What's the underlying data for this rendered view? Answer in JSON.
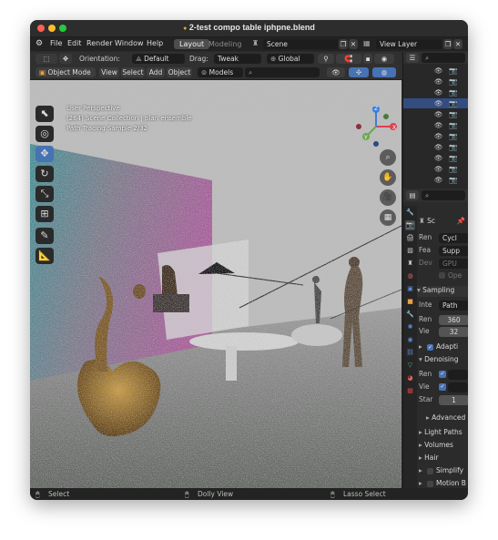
{
  "window": {
    "title": "2-test compo table iphpne.blend",
    "modified_dot": "●"
  },
  "menubar": {
    "file": "File",
    "edit": "Edit",
    "render": "Render",
    "window": "Window",
    "help": "Help",
    "tab_layout": "Layout",
    "tab_modeling": "Modeling",
    "scene": "Scene",
    "view_layer": "View Layer"
  },
  "toolbar1": {
    "orientation_label": "Orientation:",
    "orientation_value": "Default",
    "drag_label": "Drag:",
    "drag_value": "Tweak",
    "transform_value": "Global"
  },
  "toolbar2": {
    "mode": "Object Mode",
    "view": "View",
    "select": "Select",
    "add": "Add",
    "object": "Object",
    "collection": "Models"
  },
  "viewport": {
    "line1": "User Perspective",
    "line2": "(264) Scene Collection | plan ensemble",
    "line3": "Path Tracing Sample 2/32",
    "gizmo_x": "X",
    "gizmo_y": "Y",
    "gizmo_z": "Z"
  },
  "properties": {
    "tab_scene": "Sc",
    "ren_label": "Ren",
    "ren_value": "Cycl",
    "fea_label": "Fea",
    "fea_value": "Supp",
    "dev_label": "Dev",
    "dev_value": "GPU",
    "ope_label": "Ope",
    "sampling": "Sampling",
    "inte_label": "Inte",
    "inte_value": "Path",
    "render_label": "Ren",
    "render_samples": "360",
    "view_label": "Vie",
    "view_samples": "32",
    "adaptive": "Adapti",
    "denoising": "Denoising",
    "den_ren": "Ren",
    "den_vie": "Vie",
    "start_label": "Star",
    "start_value": "1",
    "advanced": "Advanced",
    "light_paths": "Light Paths",
    "volumes": "Volumes",
    "hair": "Hair",
    "simplify": "Simplify",
    "motion_blur": "Motion B"
  },
  "statusbar": {
    "select": "Select",
    "dolly": "Dolly View",
    "lasso": "Lasso Select"
  },
  "colors": {
    "accent": "#4772b3",
    "tab_active": "#4d4d4d",
    "highlight_row": "#334d80"
  }
}
